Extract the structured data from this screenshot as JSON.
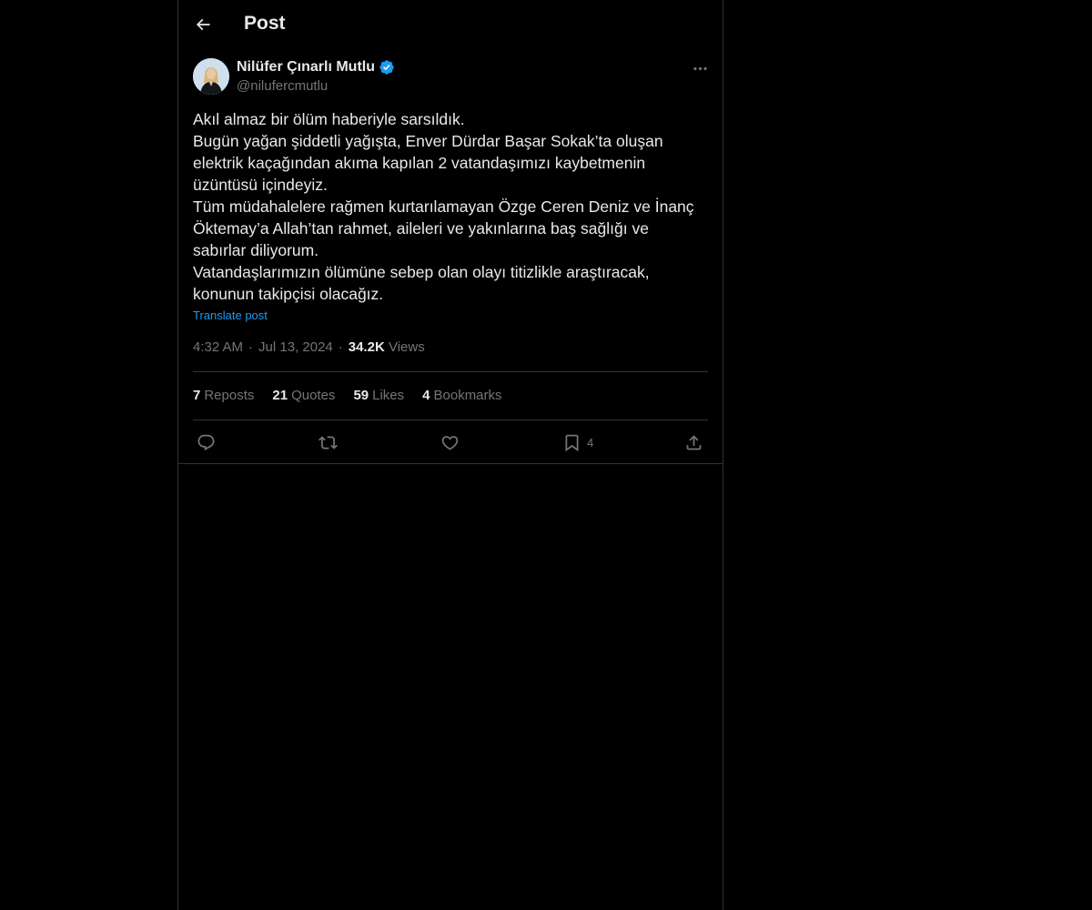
{
  "header": {
    "title": "Post"
  },
  "author": {
    "name": "Nilüfer Çınarlı Mutlu",
    "handle": "@nilufercmutlu",
    "verified": true
  },
  "tweet": {
    "lines": [
      "Akıl almaz bir ölüm haberiyle sarsıldık.",
      "Bugün yağan şiddetli yağışta, Enver Dürdar Başar Sokak’ta oluşan",
      "elektrik kaçağından akıma kapılan 2 vatandaşımızı kaybetmenin",
      "üzüntüsü içindeyiz.",
      "Tüm müdahalelere rağmen kurtarılamayan Özge Ceren Deniz ve İnanç",
      "Öktemay’a Allah’tan rahmet, aileleri ve yakınlarına baş sağlığı ve",
      "sabırlar diliyorum.",
      "Vatandaşlarımızın ölümüne sebep olan olayı titizlikle araştıracak,",
      "konunun takipçisi olacağız."
    ],
    "translate_label": "Translate post",
    "time": "4:32 AM",
    "date": "Jul 13, 2024",
    "views_count": "34.2K",
    "views_label": "Views"
  },
  "stats": {
    "reposts": {
      "count": "7",
      "label": "Reposts"
    },
    "quotes": {
      "count": "21",
      "label": "Quotes"
    },
    "likes": {
      "count": "59",
      "label": "Likes"
    },
    "bookmarks": {
      "count": "4",
      "label": "Bookmarks"
    }
  },
  "actions": {
    "bookmark_count": "4"
  },
  "colors": {
    "background": "#000000",
    "text": "#e7e9ea",
    "muted": "#71767b",
    "link": "#1d9bf0",
    "border": "#2f3336",
    "verified": "#1d9bf0"
  }
}
